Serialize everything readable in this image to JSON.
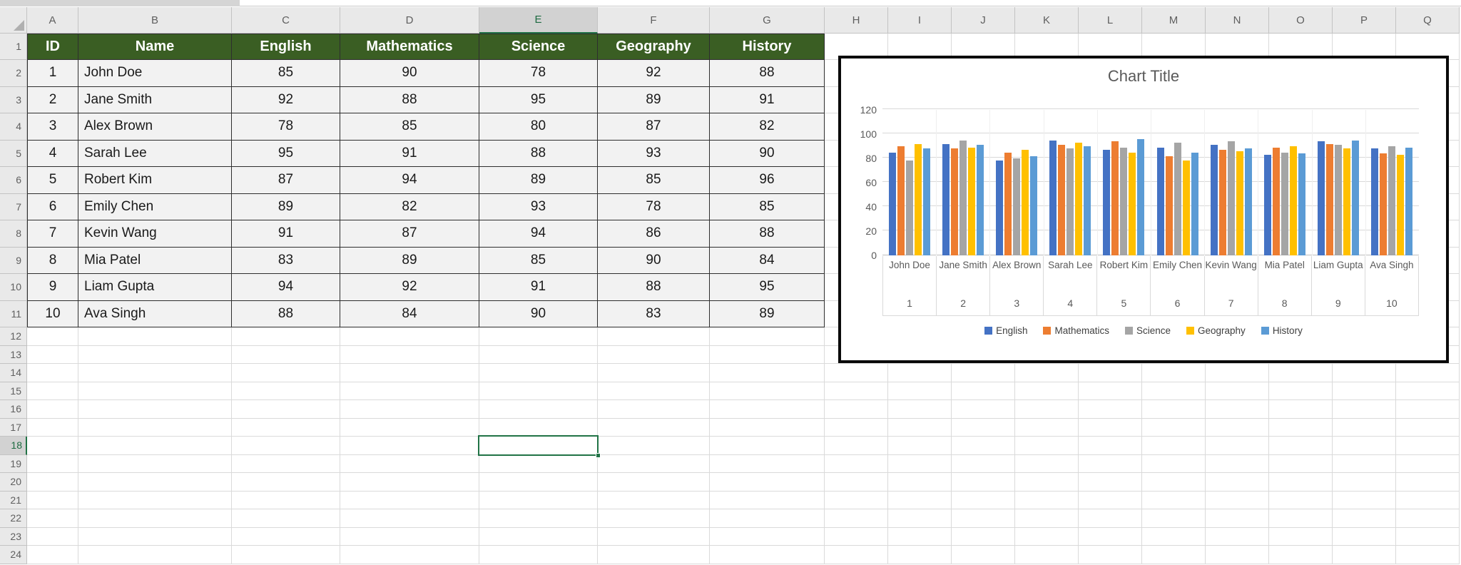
{
  "sheet": {
    "column_letters": [
      "A",
      "B",
      "C",
      "D",
      "E",
      "F",
      "G",
      "H",
      "I",
      "J",
      "K",
      "L",
      "M",
      "N",
      "O",
      "P",
      "Q"
    ],
    "row_numbers": [
      1,
      2,
      3,
      4,
      5,
      6,
      7,
      8,
      9,
      10,
      11,
      12,
      13,
      14,
      15,
      16,
      17,
      18,
      19,
      20,
      21,
      22,
      23,
      24
    ],
    "selection": {
      "cell_ref": "E18",
      "column": "E",
      "row": 18
    }
  },
  "table": {
    "headers": [
      "ID",
      "Name",
      "English",
      "Mathematics",
      "Science",
      "Geography",
      "History"
    ],
    "rows": [
      [
        1,
        "John Doe",
        85,
        90,
        78,
        92,
        88
      ],
      [
        2,
        "Jane Smith",
        92,
        88,
        95,
        89,
        91
      ],
      [
        3,
        "Alex Brown",
        78,
        85,
        80,
        87,
        82
      ],
      [
        4,
        "Sarah Lee",
        95,
        91,
        88,
        93,
        90
      ],
      [
        5,
        "Robert Kim",
        87,
        94,
        89,
        85,
        96
      ],
      [
        6,
        "Emily Chen",
        89,
        82,
        93,
        78,
        85
      ],
      [
        7,
        "Kevin Wang",
        91,
        87,
        94,
        86,
        88
      ],
      [
        8,
        "Mia Patel",
        83,
        89,
        85,
        90,
        84
      ],
      [
        9,
        "Liam Gupta",
        94,
        92,
        91,
        88,
        95
      ],
      [
        10,
        "Ava Singh",
        88,
        84,
        90,
        83,
        89
      ]
    ]
  },
  "chart_data": {
    "type": "bar",
    "title": "Chart Title",
    "categories": [
      "John Doe",
      "Jane Smith",
      "Alex Brown",
      "Sarah Lee",
      "Robert Kim",
      "Emily Chen",
      "Kevin Wang",
      "Mia Patel",
      "Liam Gupta",
      "Ava Singh"
    ],
    "category_numbers": [
      "1",
      "2",
      "3",
      "4",
      "5",
      "6",
      "7",
      "8",
      "9",
      "10"
    ],
    "series": [
      {
        "name": "English",
        "color": "#4472C4",
        "values": [
          85,
          92,
          78,
          95,
          87,
          89,
          91,
          83,
          94,
          88
        ]
      },
      {
        "name": "Mathematics",
        "color": "#ED7D31",
        "values": [
          90,
          88,
          85,
          91,
          94,
          82,
          87,
          89,
          92,
          84
        ]
      },
      {
        "name": "Science",
        "color": "#A5A5A5",
        "values": [
          78,
          95,
          80,
          88,
          89,
          93,
          94,
          85,
          91,
          90
        ]
      },
      {
        "name": "Geography",
        "color": "#FFC000",
        "values": [
          92,
          89,
          87,
          93,
          85,
          78,
          86,
          90,
          88,
          83
        ]
      },
      {
        "name": "History",
        "color": "#5B9BD5",
        "values": [
          88,
          91,
          82,
          90,
          96,
          85,
          88,
          84,
          95,
          89
        ]
      }
    ],
    "y_ticks": [
      0,
      20,
      40,
      60,
      80,
      100,
      120
    ],
    "ylim": [
      0,
      120
    ],
    "xlabel": "",
    "ylabel": "",
    "grid": true,
    "legend_position": "bottom"
  },
  "colors": {
    "table_header_bg": "#3A5E23",
    "table_header_text": "#FFFFFF",
    "selection_accent": "#217346",
    "axis_text": "#595959",
    "chart_border": "#0A0A0A"
  }
}
